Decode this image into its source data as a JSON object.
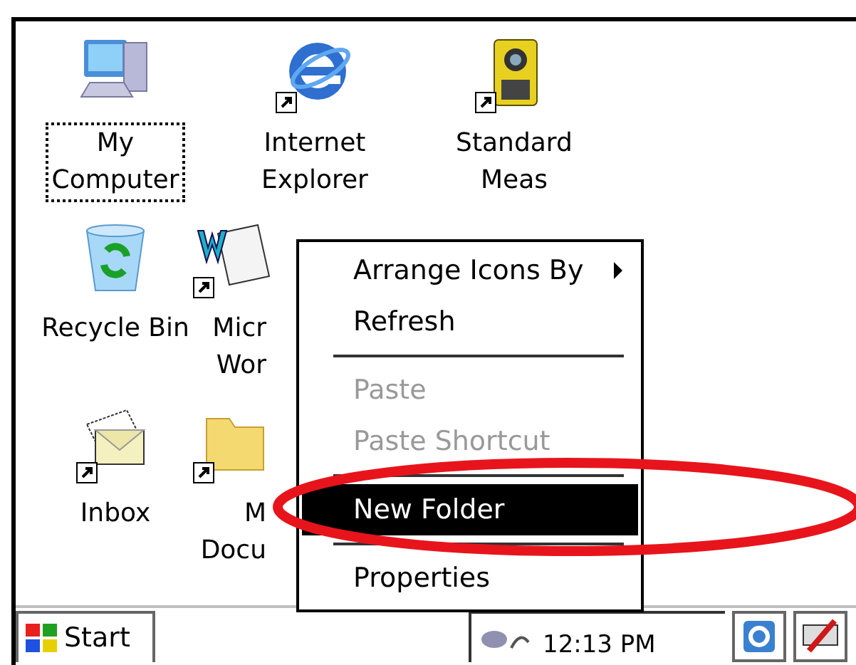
{
  "desktop": {
    "icons": [
      {
        "kind": "computer",
        "label_lines": [
          "My",
          "Computer"
        ],
        "shortcut": false,
        "selected": true
      },
      {
        "kind": "recycle-bin",
        "label_lines": [
          "Recycle Bin"
        ],
        "shortcut": false,
        "selected": false
      },
      {
        "kind": "mail",
        "label_lines": [
          "Inbox"
        ],
        "shortcut": true,
        "selected": false
      },
      {
        "kind": "browser",
        "label_lines": [
          "Internet",
          "Explorer"
        ],
        "shortcut": true,
        "selected": false
      },
      {
        "kind": "word",
        "label_lines": [
          "Micr",
          "Wor"
        ],
        "shortcut": true,
        "selected": false
      },
      {
        "kind": "folder",
        "label_lines": [
          "M",
          "Docu"
        ],
        "shortcut": true,
        "selected": false
      },
      {
        "kind": "instrument",
        "label_lines": [
          "Standard",
          "Meas"
        ],
        "shortcut": true,
        "selected": false
      }
    ]
  },
  "context_menu": {
    "items": [
      {
        "kind": "item",
        "label": "Arrange Icons By",
        "submenu": true,
        "disabled": false,
        "selected": false
      },
      {
        "kind": "item",
        "label": "Refresh",
        "submenu": false,
        "disabled": false,
        "selected": false
      },
      {
        "kind": "separator"
      },
      {
        "kind": "item",
        "label": "Paste",
        "submenu": false,
        "disabled": true,
        "selected": false
      },
      {
        "kind": "item",
        "label": "Paste Shortcut",
        "submenu": false,
        "disabled": true,
        "selected": false
      },
      {
        "kind": "separator"
      },
      {
        "kind": "item",
        "label": "New Folder",
        "submenu": false,
        "disabled": false,
        "selected": true
      },
      {
        "kind": "separator"
      },
      {
        "kind": "item",
        "label": "Properties",
        "submenu": false,
        "disabled": false,
        "selected": false
      }
    ]
  },
  "annotation": {
    "kind": "ellipse",
    "color": "#e8141c"
  },
  "taskbar": {
    "start_label": "Start",
    "clock": "12:13 PM",
    "tray_buttons": [
      {
        "kind": "connect"
      },
      {
        "kind": "pen"
      }
    ]
  }
}
